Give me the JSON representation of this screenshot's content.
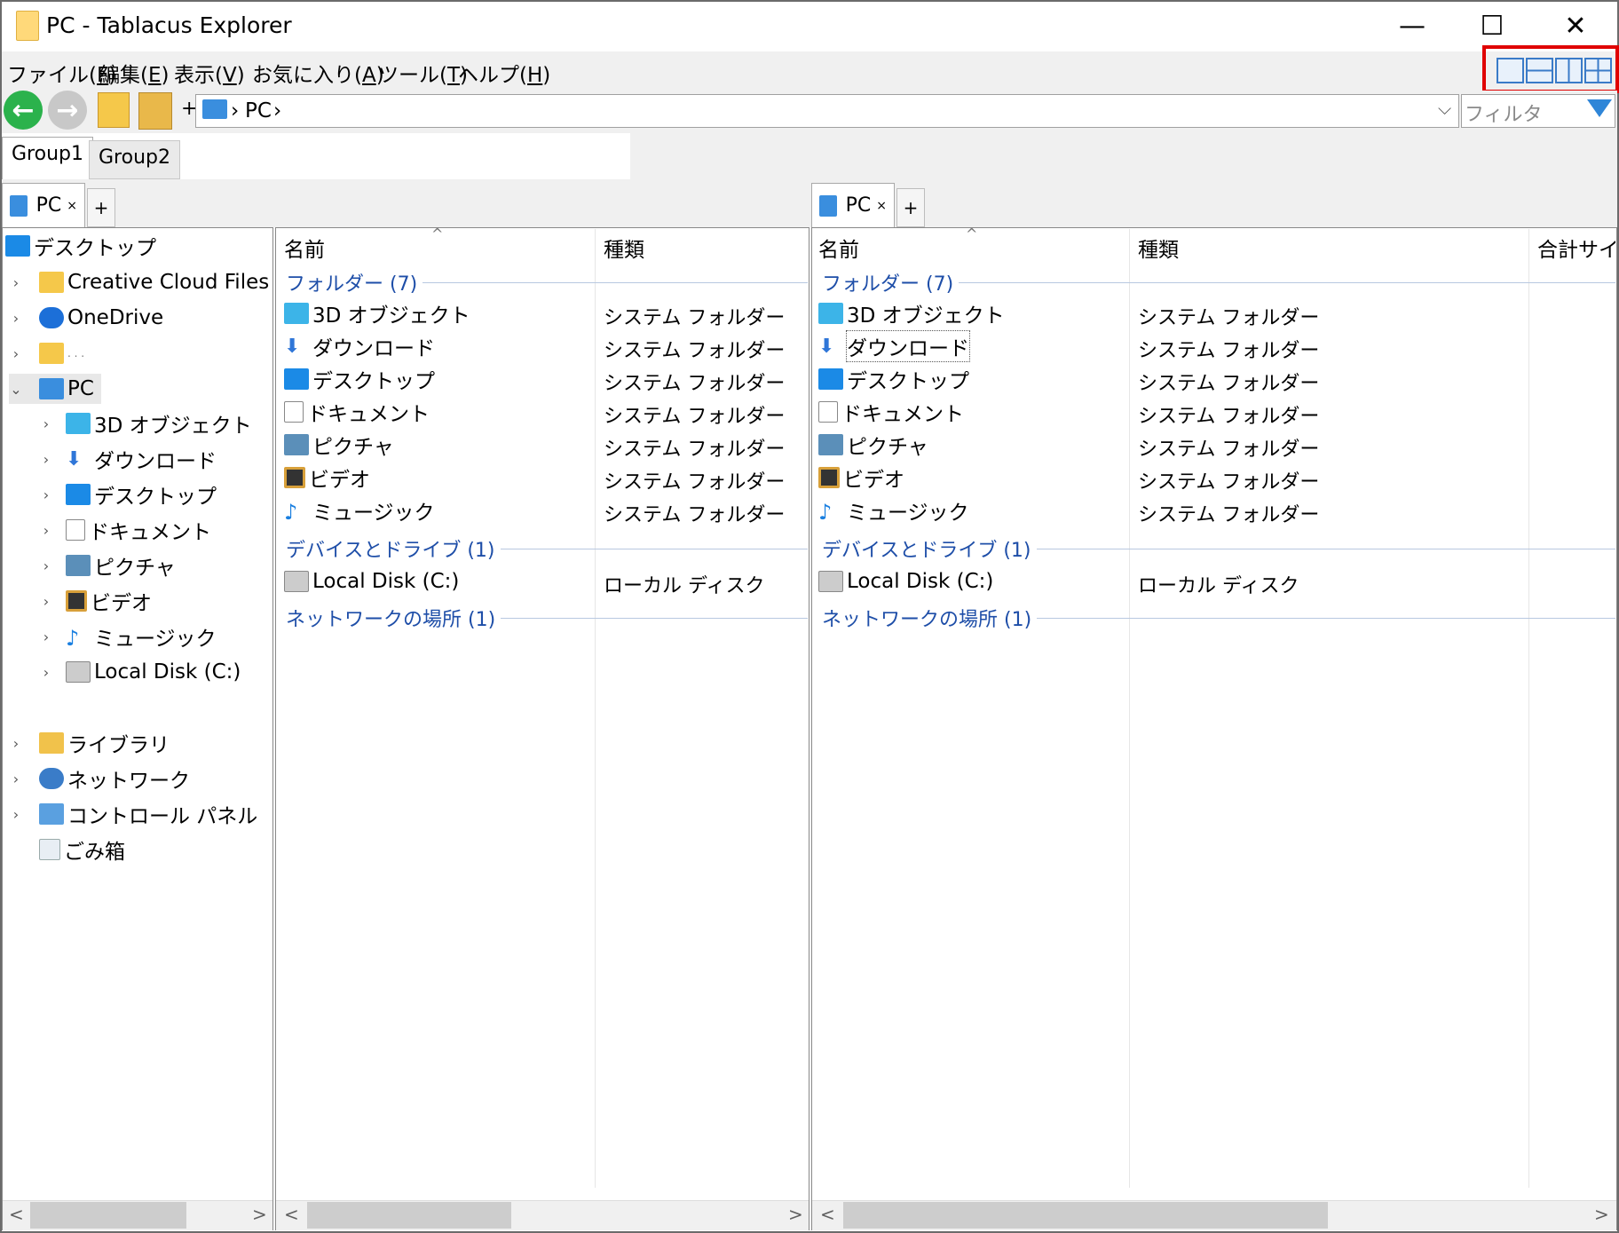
{
  "window": {
    "title": "PC - Tablacus Explorer",
    "minimize": "—",
    "maximize": "☐",
    "close": "✕"
  },
  "menu": [
    {
      "label": "ファイル(",
      "key": "F",
      "end": ")"
    },
    {
      "label": "編集(",
      "key": "E",
      "end": ")"
    },
    {
      "label": "表示(",
      "key": "V",
      "end": ")"
    },
    {
      "label": "お気に入り(",
      "key": "A",
      "end": ")"
    },
    {
      "label": "ツール(",
      "key": "T",
      "end": ")"
    },
    {
      "label": "ヘルプ(",
      "key": "H",
      "end": ")"
    }
  ],
  "toolbar": {
    "back": "←",
    "forward": "→",
    "plus": "+",
    "address_sep1": "›",
    "address": "PC",
    "address_sep2": "›",
    "dropdown": "⌵",
    "filter_placeholder": "フィルタ"
  },
  "group_tabs": [
    "Group1",
    "Group2"
  ],
  "pane_tab": {
    "label": "PC",
    "close": "×",
    "add": "+"
  },
  "tree": {
    "root": "デスクトップ",
    "items": [
      {
        "label": "Creative Cloud Files",
        "icon": "creative-cloud-icon"
      },
      {
        "label": "OneDrive",
        "icon": "onedrive-icon"
      },
      {
        "label": ". . .",
        "icon": "user-folder-icon"
      },
      {
        "label": "PC",
        "icon": "pc-icon"
      }
    ],
    "pc_children": [
      "3D オブジェクト",
      "ダウンロード",
      "デスクトップ",
      "ドキュメント",
      "ピクチャ",
      "ビデオ",
      "ミュージック",
      "Local Disk (C:)"
    ],
    "bottom": [
      "ライブラリ",
      "ネットワーク",
      "コントロール パネル",
      "ごみ箱"
    ]
  },
  "list": {
    "col_name": "名前",
    "col_type": "種類",
    "col_size": "合計サイズ",
    "sort_indicator": "^",
    "group_folders": "フォルダー (7)",
    "group_devices": "デバイスとドライブ (1)",
    "group_network": "ネットワークの場所 (1)",
    "folders": [
      {
        "name": "3D オブジェクト",
        "type": "システム フォルダー"
      },
      {
        "name": "ダウンロード",
        "type": "システム フォルダー"
      },
      {
        "name": "デスクトップ",
        "type": "システム フォルダー"
      },
      {
        "name": "ドキュメント",
        "type": "システム フォルダー"
      },
      {
        "name": "ピクチャ",
        "type": "システム フォルダー"
      },
      {
        "name": "ビデオ",
        "type": "システム フォルダー"
      },
      {
        "name": "ミュージック",
        "type": "システム フォルダー"
      }
    ],
    "devices": [
      {
        "name": "Local Disk (C:)",
        "type": "ローカル ディスク"
      }
    ]
  },
  "scroll": {
    "left": "<",
    "right": ">"
  },
  "colors": {
    "accent": "#1e4ea8",
    "highlight": "#e00000"
  }
}
